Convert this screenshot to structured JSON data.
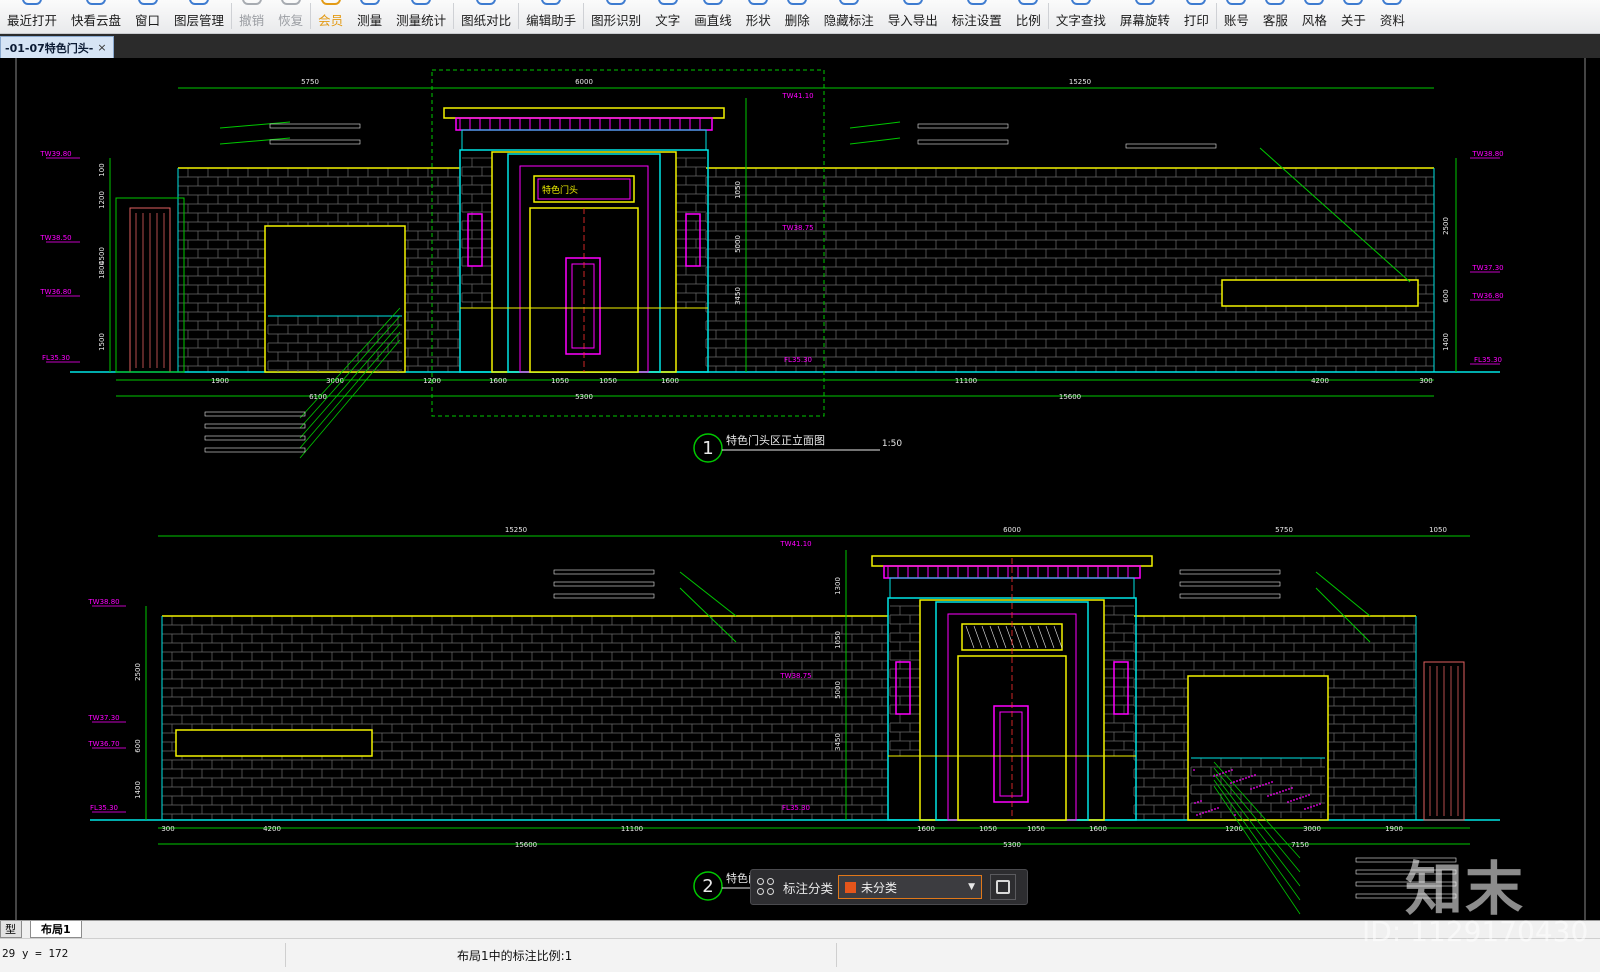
{
  "toolbar": {
    "items": [
      {
        "label": "最近打开",
        "icon": "recent-open-icon",
        "state": "normal"
      },
      {
        "label": "快看云盘",
        "icon": "cloud-disk-icon",
        "state": "normal"
      },
      {
        "label": "窗口",
        "icon": "window-icon",
        "state": "normal"
      },
      {
        "label": "图层管理",
        "icon": "layers-icon",
        "state": "normal"
      },
      {
        "label": "撤销",
        "icon": "undo-icon",
        "state": "disabled"
      },
      {
        "label": "恢复",
        "icon": "redo-icon",
        "state": "disabled"
      },
      {
        "label": "会员",
        "icon": "vip-icon",
        "state": "vip"
      },
      {
        "label": "测量",
        "icon": "measure-icon",
        "state": "normal"
      },
      {
        "label": "测量统计",
        "icon": "measure-stats-icon",
        "state": "normal"
      },
      {
        "label": "图纸对比",
        "icon": "drawing-compare-icon",
        "state": "normal"
      },
      {
        "label": "编辑助手",
        "icon": "edit-assistant-icon",
        "state": "normal"
      },
      {
        "label": "图形识别",
        "icon": "shape-recognition-icon",
        "state": "normal"
      },
      {
        "label": "文字",
        "icon": "text-icon",
        "state": "normal"
      },
      {
        "label": "画直线",
        "icon": "line-icon",
        "state": "normal"
      },
      {
        "label": "形状",
        "icon": "shape-icon",
        "state": "normal"
      },
      {
        "label": "删除",
        "icon": "delete-icon",
        "state": "normal"
      },
      {
        "label": "隐藏标注",
        "icon": "hide-annotation-icon",
        "state": "normal"
      },
      {
        "label": "导入导出",
        "icon": "import-export-icon",
        "state": "normal"
      },
      {
        "label": "标注设置",
        "icon": "annotation-settings-icon",
        "state": "normal"
      },
      {
        "label": "比例",
        "icon": "scale-icon",
        "state": "normal"
      },
      {
        "label": "文字查找",
        "icon": "text-search-icon",
        "state": "normal"
      },
      {
        "label": "屏幕旋转",
        "icon": "screen-rotate-icon",
        "state": "normal"
      },
      {
        "label": "打印",
        "icon": "print-icon",
        "state": "normal"
      },
      {
        "label": "账号",
        "icon": "account-icon",
        "state": "normal"
      },
      {
        "label": "客服",
        "icon": "customer-service-icon",
        "state": "normal"
      },
      {
        "label": "风格",
        "icon": "style-icon",
        "state": "normal"
      },
      {
        "label": "关于",
        "icon": "about-icon",
        "state": "normal"
      },
      {
        "label": "资料",
        "icon": "resources-icon",
        "state": "normal"
      }
    ]
  },
  "document_tab": {
    "title": "-01-07特色门头-",
    "close": "×"
  },
  "drawing": {
    "elevation1": {
      "number": "1",
      "title": "特色门头区正立面图",
      "scale": "1:50",
      "top_dims": [
        "5750",
        "6000",
        "15250"
      ],
      "bottom_dims_row1": [
        "1900",
        "3000",
        "1200",
        "1600",
        "1050",
        "1050",
        "1600",
        "11100",
        "4200",
        "300"
      ],
      "bottom_dims_row2": [
        "6100",
        "5300",
        "15600"
      ],
      "left_levels": [
        "TW39.80",
        "TW38.50",
        "TW36.80",
        "FL35.30"
      ],
      "right_levels": [
        "TW38.80",
        "TW37.30",
        "TW36.80",
        "FL35.30"
      ],
      "left_vdims": [
        "100",
        "1200",
        "1800",
        "4500",
        "1500"
      ],
      "right_vdims": [
        "2500",
        "600",
        "1400"
      ],
      "center_vdims": [
        "1050",
        "5000",
        "3450"
      ],
      "center_levels": [
        "TW41.10",
        "TW38.75",
        "FL35.30"
      ],
      "plaque": "特色门头"
    },
    "elevation2": {
      "number": "2",
      "title": "特色门头",
      "top_dims": [
        "15250",
        "6000",
        "5750",
        "1050"
      ],
      "bottom_dims_row1": [
        "300",
        "4200",
        "11100",
        "1600",
        "1050",
        "1050",
        "1600",
        "1200",
        "3000",
        "1900"
      ],
      "bottom_dims_row2": [
        "15600",
        "5300",
        "7150"
      ],
      "left_levels": [
        "TW38.80",
        "TW37.30",
        "TW36.70",
        "FL35.30"
      ],
      "left_vdims": [
        "2500",
        "600",
        "1400"
      ],
      "center_vdims": [
        "1300",
        "1050",
        "5000",
        "3450"
      ],
      "center_levels": [
        "TW41.10",
        "TW38.75",
        "FL35.30"
      ]
    }
  },
  "layout_tabs": [
    "型",
    "布局1"
  ],
  "status": {
    "coords": "29 y = 172",
    "scale_text": "布局1中的标注比例:1"
  },
  "annotation_bar": {
    "label": "标注分类",
    "selected": "未分类",
    "swatch_color": "#e5551b"
  },
  "watermark": {
    "brand": "知末",
    "id": "ID: 1129170430"
  },
  "colors": {
    "wall_yellow": "#f2f200",
    "cyan": "#00e5e5",
    "magenta": "#ff00ff",
    "green_dim": "#00c800",
    "brick": "#6b6b6b"
  }
}
